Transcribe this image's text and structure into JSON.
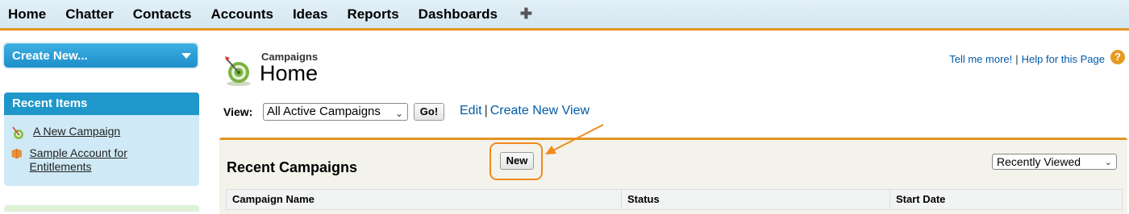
{
  "nav": {
    "tabs": [
      "Home",
      "Chatter",
      "Contacts",
      "Accounts",
      "Ideas",
      "Reports",
      "Dashboards"
    ],
    "plus_label": "✚"
  },
  "sidebar": {
    "create_new": "Create New...",
    "recent_items_title": "Recent Items",
    "recent_items": [
      {
        "label": "A New Campaign",
        "icon": "campaign-icon"
      },
      {
        "label": "Sample Account for Entitlements",
        "icon": "account-icon"
      }
    ]
  },
  "header": {
    "object_label": "Campaigns",
    "title": "Home",
    "tell_me_more": "Tell me more!",
    "separator": "|",
    "help_link": "Help for this Page",
    "help_icon": "?"
  },
  "view": {
    "label": "View:",
    "selected": "All Active Campaigns",
    "go": "Go!",
    "edit": "Edit",
    "separator": "|",
    "create_new_view": "Create New View"
  },
  "recent_campaigns": {
    "title": "Recent Campaigns",
    "new_button": "New",
    "sort_selected": "Recently Viewed",
    "columns": [
      "Campaign Name",
      "Status",
      "Start Date"
    ]
  },
  "colors": {
    "accent_orange": "#e39321",
    "sidebar_blue": "#1f97ca",
    "link_blue": "#015ba7"
  }
}
